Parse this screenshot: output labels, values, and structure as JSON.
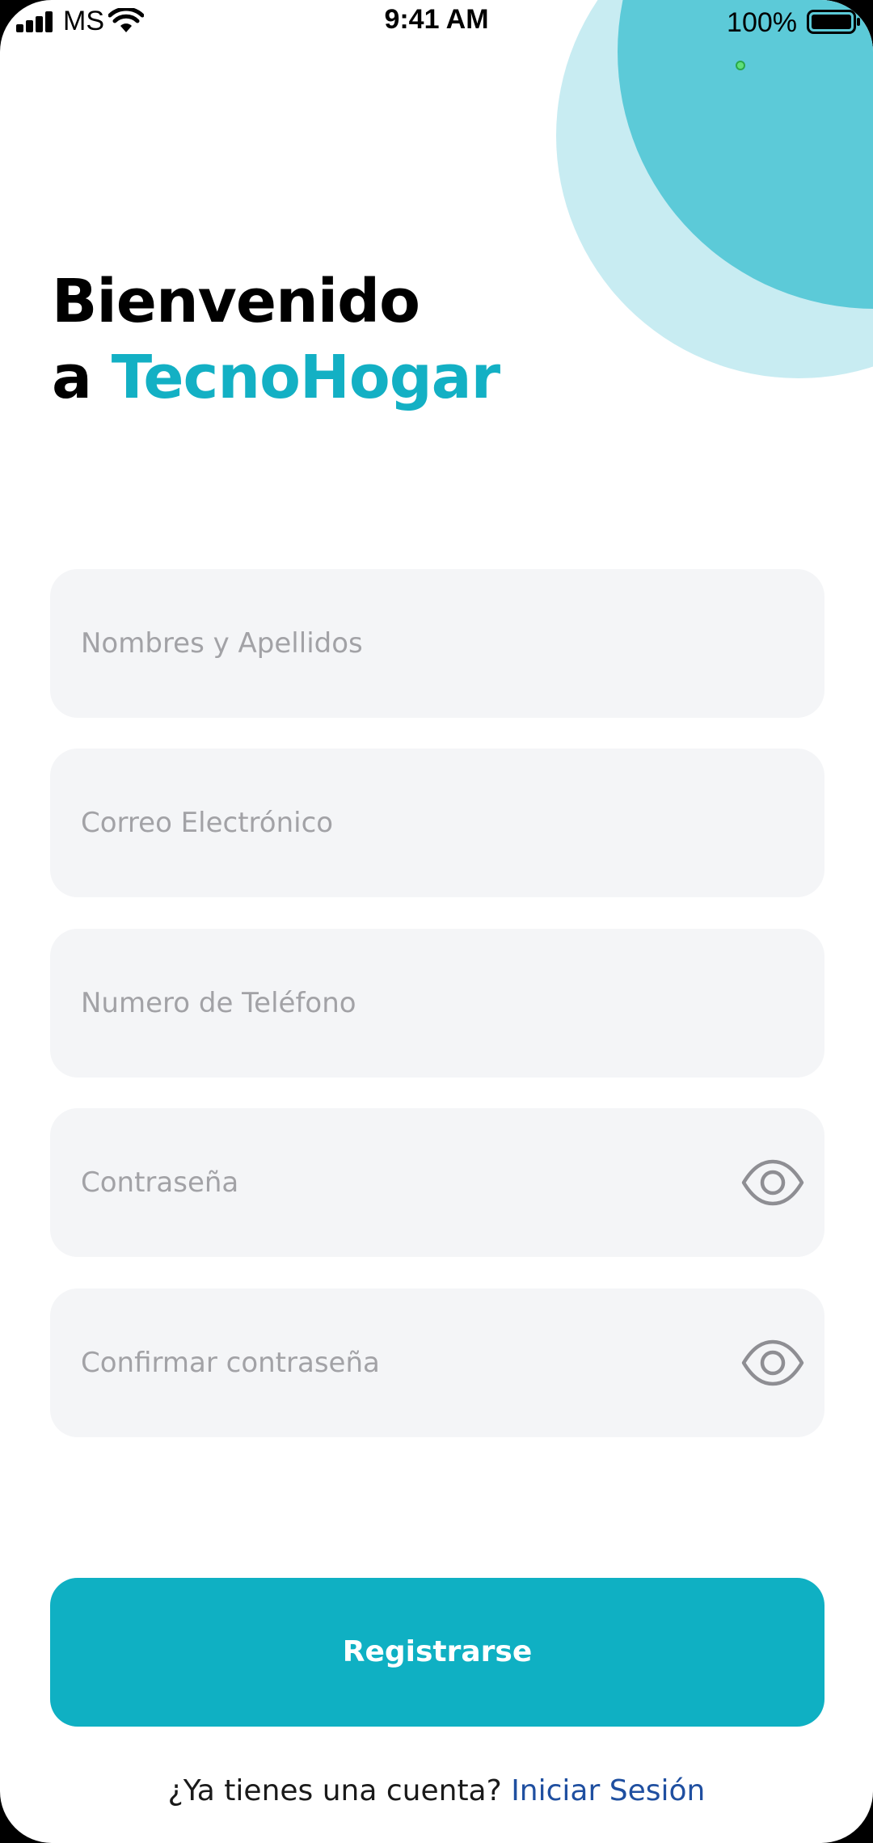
{
  "status_bar": {
    "carrier": "MS",
    "time": "9:41 AM",
    "battery": "100%"
  },
  "heading": {
    "line1": "Bienvenido",
    "line2_prefix": "a",
    "brand": "TecnoHogar"
  },
  "form": {
    "full_name_placeholder": "Nombres y Apellidos",
    "email_placeholder": "Correo Electrónico",
    "phone_placeholder": "Numero de Teléfono",
    "password_placeholder": "Contraseña",
    "confirm_password_placeholder": "Confirmar contraseña"
  },
  "actions": {
    "register_label": "Registrarse",
    "have_account_text": "¿Ya tienes una cuenta?",
    "login_link": "Iniciar Sesión"
  },
  "colors": {
    "brand": "#13b0c4",
    "button": "#0fb0c3",
    "field_bg": "#f4f5f7",
    "link": "#1f4fa0",
    "circle_light": "#c8ecf2",
    "circle_dark": "#5ccad8"
  },
  "icons": {
    "password_toggle": "eye-icon",
    "confirm_password_toggle": "eye-icon"
  }
}
